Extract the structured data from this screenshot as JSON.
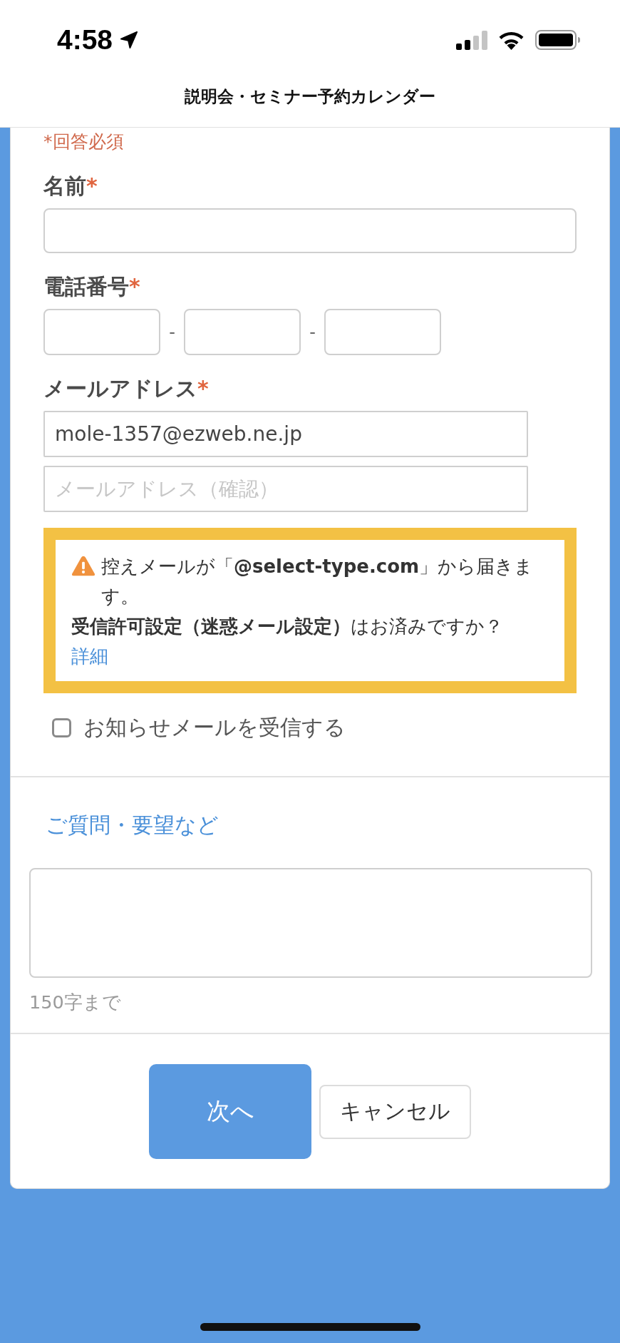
{
  "status_bar": {
    "time": "4:58"
  },
  "header": {
    "title": "説明会・セミナー予約カレンダー"
  },
  "form": {
    "required_note": "*回答必須",
    "fields": [
      {
        "kind": "text",
        "label": "名前",
        "required_mark": "*"
      },
      {
        "kind": "phone",
        "label": "電話番号",
        "required_mark": "*",
        "separators": [
          "-",
          "-"
        ]
      },
      {
        "kind": "email",
        "label": "メールアドレス",
        "required_mark": "*",
        "value": "mole-1357@ezweb.ne.jp",
        "confirm": {
          "placeholder": "メールアドレス（確認）"
        }
      }
    ],
    "notice": {
      "lines": [
        "控えメールが「**@select-type.com**」から届きます。",
        "**受信許可設定（迷惑メール設定）**はお済みですか？"
      ],
      "link": "詳細"
    },
    "newsletter": {
      "label": "お知らせメールを受信する",
      "checked": false
    }
  },
  "questions": {
    "label": "ご質問・要望など",
    "hint": "150字まで"
  },
  "buttons": [
    {
      "label": "次へ",
      "kind": "primary"
    },
    {
      "label": "キャンセル",
      "kind": "secondary"
    }
  ]
}
